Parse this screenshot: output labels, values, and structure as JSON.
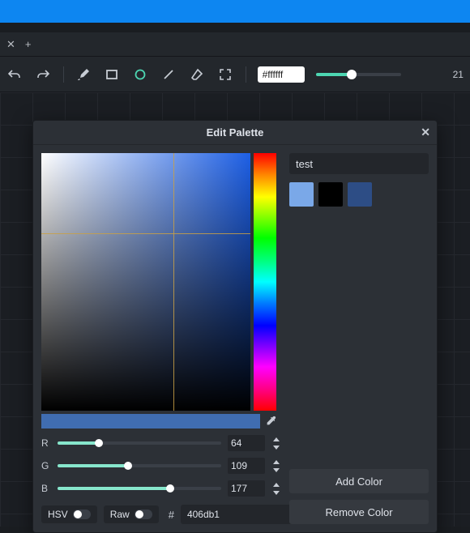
{
  "toolbar": {
    "hex": "#ffffff",
    "thickness": "21"
  },
  "dialog": {
    "title": "Edit Palette",
    "palette_name": "test",
    "r_label": "R",
    "g_label": "G",
    "b_label": "B",
    "r": "64",
    "g": "109",
    "b": "177",
    "r_pct": 25,
    "g_pct": 43,
    "b_pct": 69,
    "hsv_label": "HSV",
    "raw_label": "Raw",
    "hash": "#",
    "hex": "406db1",
    "preview_color": "#406db1",
    "hue": "#1d5fe5",
    "swatches": [
      {
        "color": "#7aa8e8",
        "selected": true
      },
      {
        "color": "#000000",
        "selected": false
      },
      {
        "color": "#2d4d85",
        "selected": false
      }
    ],
    "add_label": "Add Color",
    "remove_label": "Remove Color"
  }
}
